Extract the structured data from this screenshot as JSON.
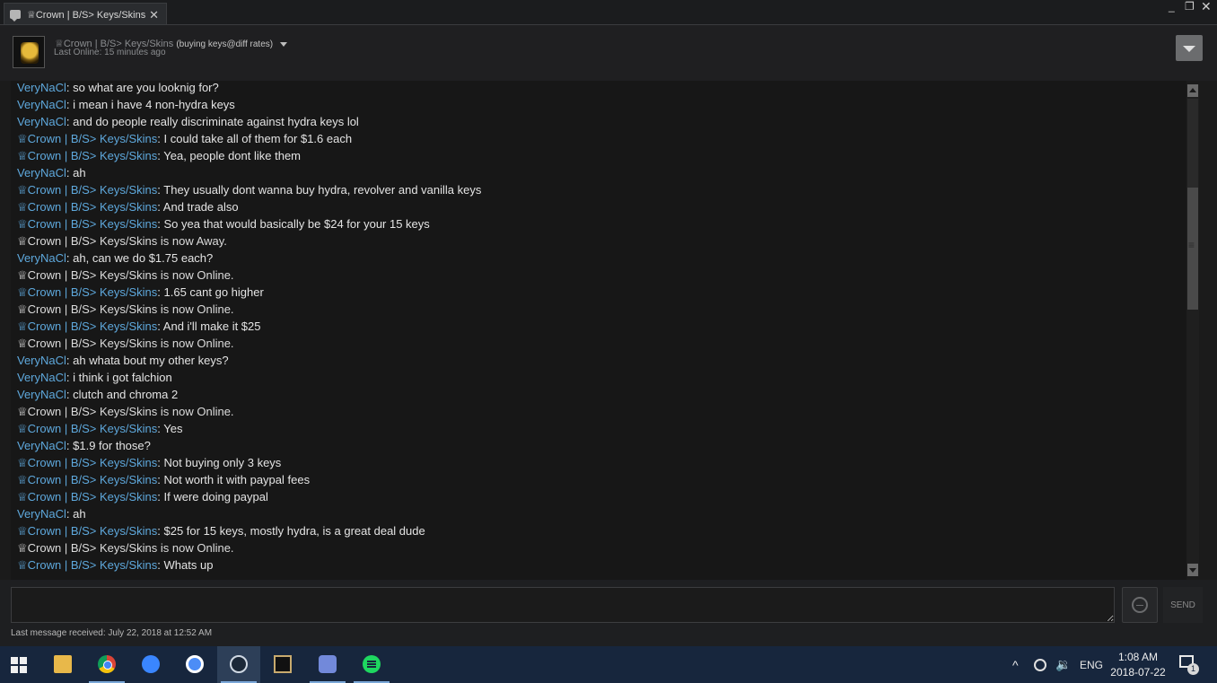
{
  "window": {
    "tab_title": "♕Crown | B/S> Keys/Skins",
    "tab_close": "✕",
    "min_glyph": "_",
    "max_glyph": "❐",
    "close_glyph": "✕"
  },
  "header": {
    "contact_name": "♕Crown | B/S> Keys/Skins",
    "status_message": "(buying keys@diff rates)",
    "last_online": "Last Online: 15 minutes ago"
  },
  "senders": {
    "you": "VeryNaCl",
    "contact": "♕Crown | B/S> Keys/Skins"
  },
  "messages": [
    {
      "who": "you",
      "text": ": so what are you looknig for?"
    },
    {
      "who": "you",
      "text": ": i mean i have 4 non-hydra keys"
    },
    {
      "who": "you",
      "text": ": and do people really discriminate against hydra keys lol"
    },
    {
      "who": "contact",
      "text": ": I could take all of them for $1.6 each"
    },
    {
      "who": "contact",
      "text": ": Yea, people dont like them"
    },
    {
      "who": "you",
      "text": ": ah"
    },
    {
      "who": "contact",
      "text": ": They usually dont wanna buy hydra, revolver and vanilla keys"
    },
    {
      "who": "contact",
      "text": ": And trade also"
    },
    {
      "who": "contact",
      "text": ": So yea that would basically be $24 for your 15 keys"
    },
    {
      "who": "system",
      "text": "♕Crown | B/S> Keys/Skins is now Away."
    },
    {
      "who": "you",
      "text": ": ah, can we do $1.75 each?"
    },
    {
      "who": "system",
      "text": "♕Crown | B/S> Keys/Skins is now Online."
    },
    {
      "who": "contact",
      "text": ": 1.65 cant go higher"
    },
    {
      "who": "system",
      "text": "♕Crown | B/S> Keys/Skins is now Online."
    },
    {
      "who": "contact",
      "text": ": And i'll make it $25"
    },
    {
      "who": "system",
      "text": "♕Crown | B/S> Keys/Skins is now Online."
    },
    {
      "who": "you",
      "text": ": ah whata bout my other keys?"
    },
    {
      "who": "you",
      "text": ": i think i got falchion"
    },
    {
      "who": "you",
      "text": ": clutch and chroma 2"
    },
    {
      "who": "system",
      "text": "♕Crown | B/S> Keys/Skins is now Online."
    },
    {
      "who": "contact",
      "text": ": Yes"
    },
    {
      "who": "you",
      "text": ": $1.9 for those?"
    },
    {
      "who": "contact",
      "text": ": Not buying only 3 keys"
    },
    {
      "who": "contact",
      "text": ": Not worth it with paypal fees"
    },
    {
      "who": "contact",
      "text": ": If were doing paypal"
    },
    {
      "who": "you",
      "text": ": ah"
    },
    {
      "who": "contact",
      "text": ": $25 for 15 keys, mostly hydra, is a great deal dude"
    },
    {
      "who": "system",
      "text": "♕Crown | B/S> Keys/Skins is now Online."
    },
    {
      "who": "contact",
      "text": ": Whats up"
    }
  ],
  "composer": {
    "input_value": "",
    "send_label": "SEND",
    "last_received": "Last message received: July 22, 2018 at 12:52 AM"
  },
  "taskbar": {
    "apps": [
      "start-icon",
      "file-explorer-icon",
      "chrome-icon",
      "app-icon",
      "app-icon",
      "steam-icon",
      "league-of-legends-icon",
      "discord-icon",
      "spotify-icon"
    ],
    "tray_chevron": "^",
    "tray_volume": "🔉",
    "language": "ENG",
    "time": "1:08 AM",
    "date": "2018-07-22",
    "notification_count": "1"
  },
  "colors": {
    "sender_blue": "#5ea8dc",
    "background": "#171717",
    "taskbar": "#17263d"
  }
}
